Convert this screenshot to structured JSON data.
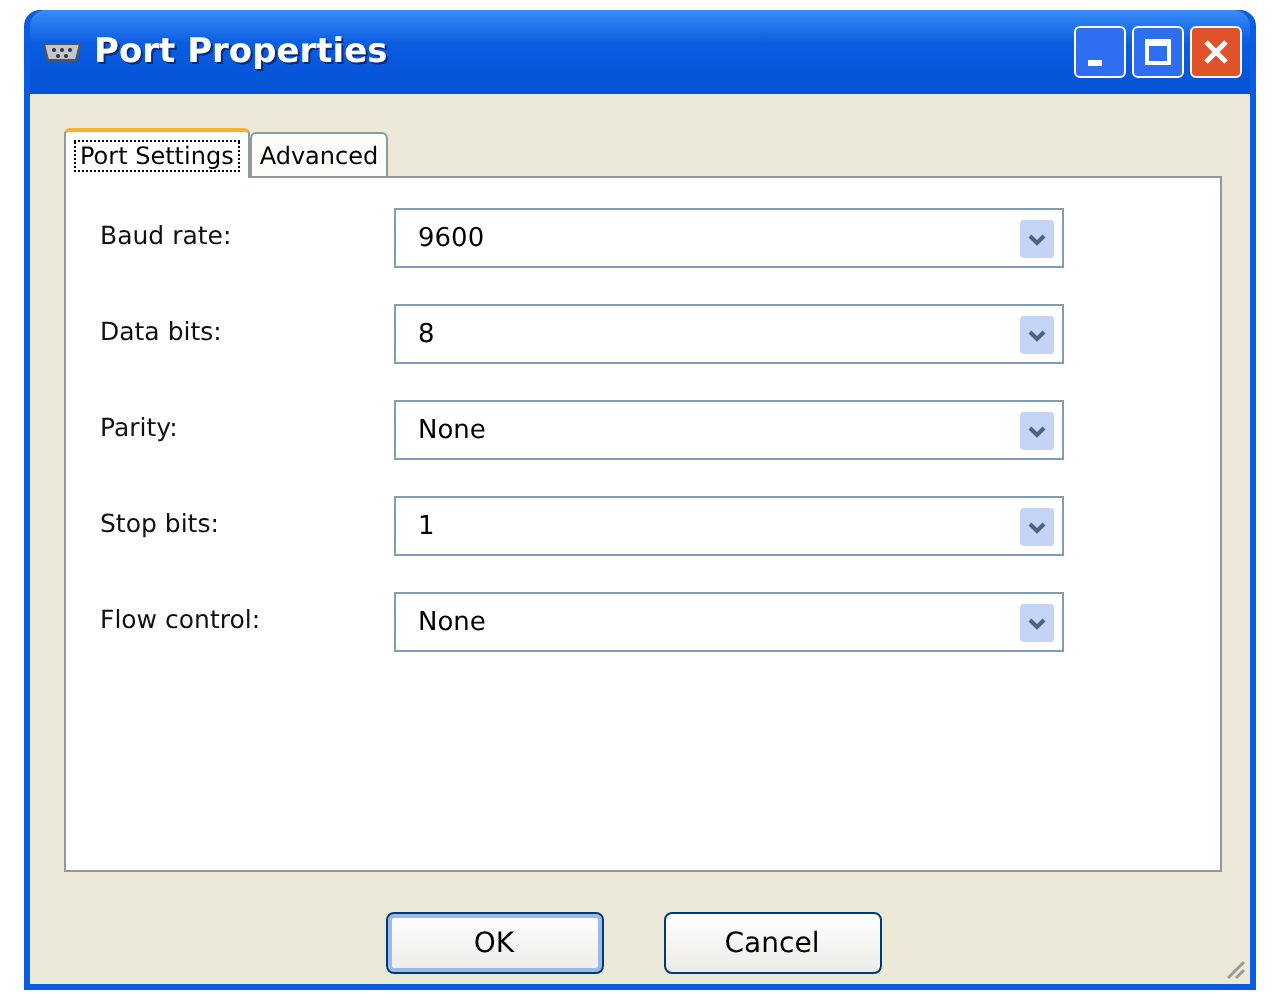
{
  "window": {
    "title": "Port Properties"
  },
  "tabs": [
    {
      "label": "Port Settings",
      "selected": true
    },
    {
      "label": "Advanced",
      "selected": false
    }
  ],
  "fields": [
    {
      "label": "Baud rate:",
      "value": "9600"
    },
    {
      "label": "Data bits:",
      "value": "8"
    },
    {
      "label": "Parity:",
      "value": "None"
    },
    {
      "label": "Stop bits:",
      "value": "1"
    },
    {
      "label": "Flow control:",
      "value": "None"
    }
  ],
  "buttons": [
    "OK",
    "Cancel"
  ]
}
